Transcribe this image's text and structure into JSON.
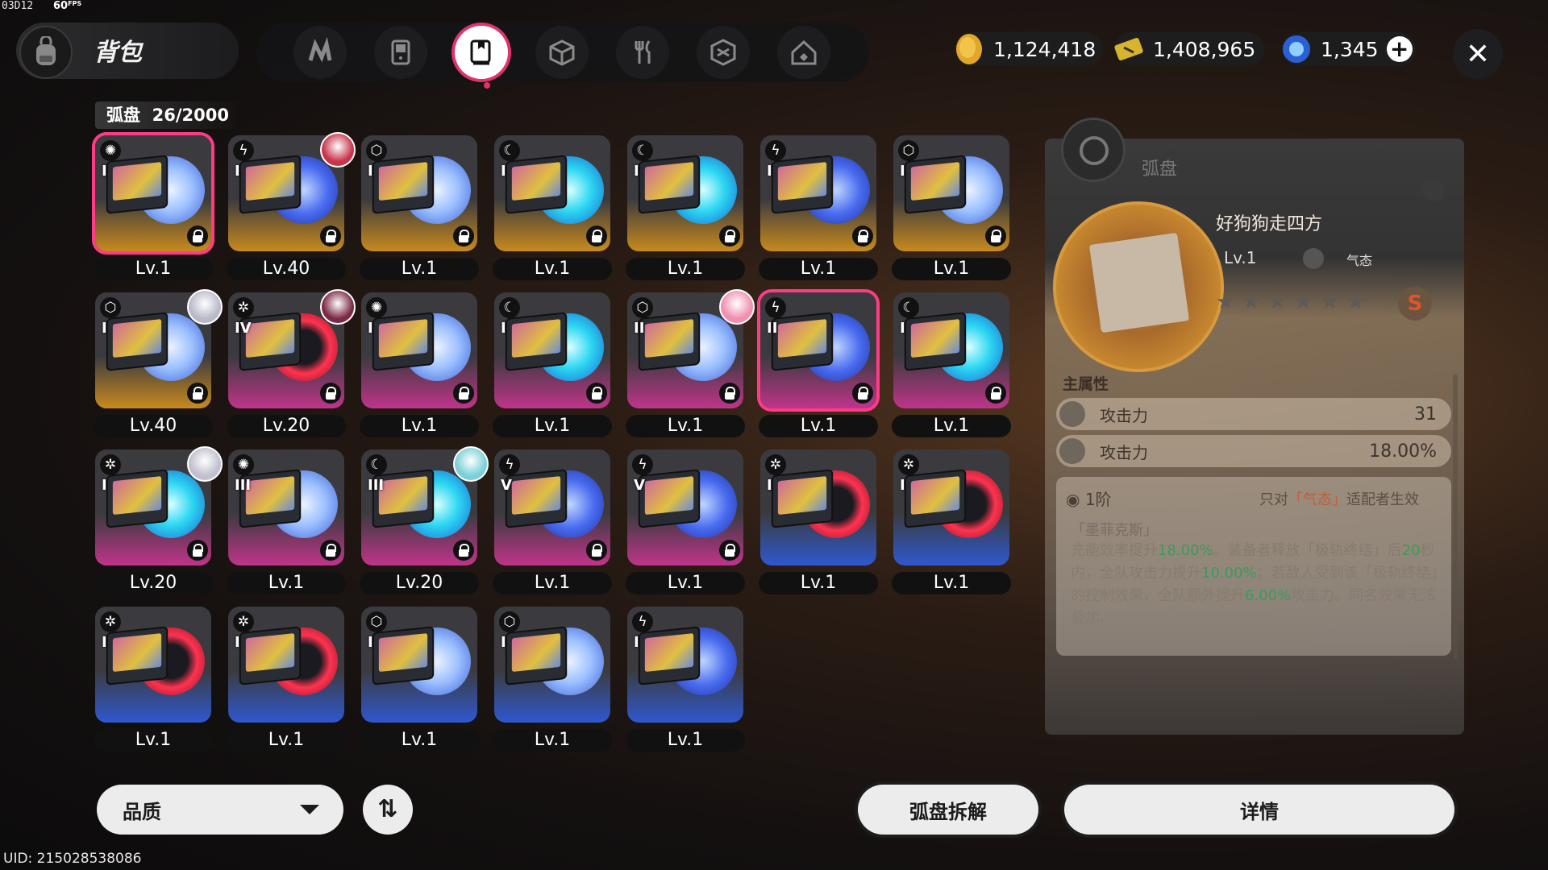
{
  "debug": {
    "build": "03D12",
    "fps": "60",
    "fps_unit": "FPS"
  },
  "header": {
    "title": "背包",
    "tabs": [
      "drive-tab",
      "console-tab",
      "disc-tab",
      "box-tab",
      "food-tab",
      "material-tab",
      "home-tab"
    ],
    "active_tab": 2,
    "currencies": [
      {
        "name": "coin",
        "value": "1,124,418"
      },
      {
        "name": "ticket",
        "value": "1,408,965"
      },
      {
        "name": "crystal",
        "value": "1,345"
      }
    ]
  },
  "grid": {
    "count_label": "弧盘",
    "count": "26/2000",
    "items": [
      {
        "level": "Lv.1",
        "slot": "I",
        "rarity": "gold",
        "attr": "whirl",
        "disc": "white",
        "lock": true,
        "selected": true
      },
      {
        "level": "Lv.40",
        "slot": "I",
        "rarity": "gold",
        "attr": "bolt",
        "disc": "blue",
        "lock": true,
        "avatar": "#c8344a"
      },
      {
        "level": "Lv.1",
        "slot": "I",
        "rarity": "gold",
        "attr": "cube",
        "disc": "white",
        "lock": true
      },
      {
        "level": "Lv.1",
        "slot": "I",
        "rarity": "gold",
        "attr": "moon",
        "disc": "cyan",
        "lock": true
      },
      {
        "level": "Lv.1",
        "slot": "I",
        "rarity": "gold",
        "attr": "moon",
        "disc": "cyan",
        "lock": true
      },
      {
        "level": "Lv.1",
        "slot": "I",
        "rarity": "gold",
        "attr": "bolt",
        "disc": "blue",
        "lock": true
      },
      {
        "level": "Lv.1",
        "slot": "I",
        "rarity": "gold",
        "attr": "cube",
        "disc": "white",
        "lock": true
      },
      {
        "level": "Lv.40",
        "slot": "I",
        "rarity": "gold",
        "attr": "cube",
        "disc": "white",
        "lock": true,
        "avatar": "#b9b9c9"
      },
      {
        "level": "Lv.20",
        "slot": "IV",
        "rarity": "pink",
        "attr": "gear",
        "disc": "red",
        "lock": true,
        "avatar": "#7a2a44"
      },
      {
        "level": "Lv.1",
        "slot": "I",
        "rarity": "pink",
        "attr": "whirl",
        "disc": "white",
        "lock": true
      },
      {
        "level": "Lv.1",
        "slot": "I",
        "rarity": "pink",
        "attr": "moon",
        "disc": "cyan",
        "lock": true
      },
      {
        "level": "Lv.1",
        "slot": "II",
        "rarity": "pink",
        "attr": "cube",
        "disc": "white",
        "lock": true,
        "avatar": "#f08fb0"
      },
      {
        "level": "Lv.1",
        "slot": "II",
        "rarity": "pink",
        "attr": "bolt",
        "disc": "blue",
        "lock": true,
        "selected": true
      },
      {
        "level": "Lv.1",
        "slot": "I",
        "rarity": "pink",
        "attr": "moon",
        "disc": "cyan",
        "lock": true
      },
      {
        "level": "Lv.20",
        "slot": "I",
        "rarity": "pink",
        "attr": "gear",
        "disc": "cyan",
        "lock": true,
        "avatar": "#c0c0d0"
      },
      {
        "level": "Lv.1",
        "slot": "III",
        "rarity": "pink",
        "attr": "whirl",
        "disc": "white",
        "lock": true
      },
      {
        "level": "Lv.20",
        "slot": "III",
        "rarity": "pink",
        "attr": "moon",
        "disc": "cyan",
        "lock": true,
        "avatar": "#7bd0d8"
      },
      {
        "level": "Lv.1",
        "slot": "V",
        "rarity": "pink",
        "attr": "bolt",
        "disc": "blue",
        "lock": true
      },
      {
        "level": "Lv.1",
        "slot": "V",
        "rarity": "pink",
        "attr": "bolt",
        "disc": "blue",
        "lock": true
      },
      {
        "level": "Lv.1",
        "slot": "I",
        "rarity": "blue",
        "attr": "gear",
        "disc": "red",
        "lock": false
      },
      {
        "level": "Lv.1",
        "slot": "I",
        "rarity": "blue",
        "attr": "gear",
        "disc": "red",
        "lock": false
      },
      {
        "level": "Lv.1",
        "slot": "I",
        "rarity": "blue",
        "attr": "gear",
        "disc": "red",
        "lock": false
      },
      {
        "level": "Lv.1",
        "slot": "I",
        "rarity": "blue",
        "attr": "gear",
        "disc": "red",
        "lock": false
      },
      {
        "level": "Lv.1",
        "slot": "I",
        "rarity": "blue",
        "attr": "cube",
        "disc": "white",
        "lock": false
      },
      {
        "level": "Lv.1",
        "slot": "I",
        "rarity": "blue",
        "attr": "cube",
        "disc": "white",
        "lock": false
      },
      {
        "level": "Lv.1",
        "slot": "I",
        "rarity": "blue",
        "attr": "bolt",
        "disc": "blue",
        "lock": false
      }
    ]
  },
  "detail": {
    "type_label": "弧盘",
    "name": "好狗狗走四方",
    "level": "Lv.1",
    "attr_name": "气态",
    "stars": "★★★★★★",
    "rank": "S",
    "main_section": "主属性",
    "props": [
      {
        "name": "攻击力",
        "value": "31"
      },
      {
        "name": "攻击力",
        "value": "18.00%"
      }
    ],
    "tier": "1阶",
    "tier_note_pre": "只对",
    "tier_note_hl": "「气态」",
    "tier_note_post": "适配者生效",
    "effect_title": "「墨菲克斯」",
    "effect_p1": "充能效率提升",
    "effect_v1": "18.00%",
    "effect_p2": "。装备者释放「极轨终结」后",
    "effect_v2": "20",
    "effect_p3": "秒内，全队攻击力提升",
    "effect_v3": "10.00%",
    "effect_p4": "；若敌人受到该「极轨终结」的控制效果，全队额外提升",
    "effect_v4": "6.00%",
    "effect_p5": "攻击力。同名效果无法叠加。"
  },
  "footer": {
    "sort_label": "品质",
    "order_icon": "⇅",
    "dismantle": "弧盘拆解",
    "details": "详情",
    "uid": "UID: 215028538086"
  },
  "colors": {
    "gold": "#d99b2a",
    "pink": "#c43b8c",
    "blue": "#3a5fd6",
    "accent": "#ff3b86"
  }
}
